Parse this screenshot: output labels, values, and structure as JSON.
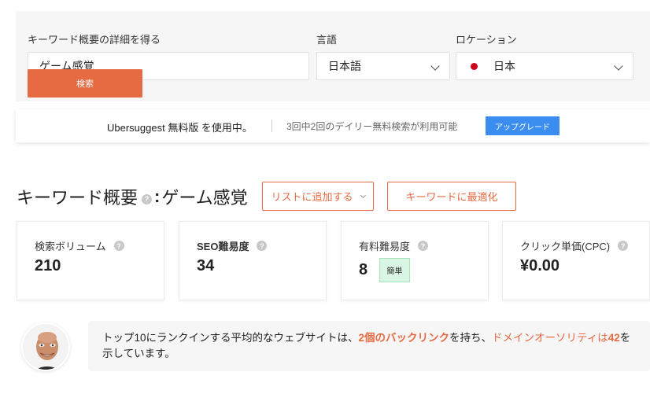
{
  "search": {
    "keyword_label": "キーワード概要の詳細を得る",
    "keyword_value": "ゲーム感覚",
    "language_label": "言語",
    "language_value": "日本語",
    "location_label": "ロケーション",
    "location_value": "日本",
    "submit_label": "検索"
  },
  "plan": {
    "status": "Ubersuggest 無料版 を使用中。",
    "usage": "3回中2回のデイリー無料検索が利用可能",
    "upgrade_label": "アップグレード"
  },
  "overview": {
    "title": "キーワード概要",
    "help": "?",
    "colon": ":",
    "keyword": "ゲーム感覚",
    "add_to_list_label": "リストに追加する",
    "optimize_label": "キーワードに最適化"
  },
  "metrics": [
    {
      "label": "検索ボリューム",
      "value": "210"
    },
    {
      "label": "SEO難易度",
      "value": "34"
    },
    {
      "label": "有料難易度",
      "value": "8",
      "badge": "簡単"
    },
    {
      "label": "クリック単価(CPC)",
      "value": "¥0.00"
    }
  ],
  "insight": {
    "part1": "トップ10にランクインする平均的なウェブサイトは、",
    "backlinks": "2個のバックリンク",
    "part2": "を持ち、",
    "authority_text": "ドメインオーソリティは",
    "authority_value": "42",
    "part3": "を示しています。"
  },
  "colors": {
    "accent": "#e66a42",
    "upgrade": "#3b8df0",
    "easy_badge": "#d9f5e3"
  },
  "icons": [
    "help-icon",
    "chevron-down-icon",
    "japan-flag-icon"
  ]
}
